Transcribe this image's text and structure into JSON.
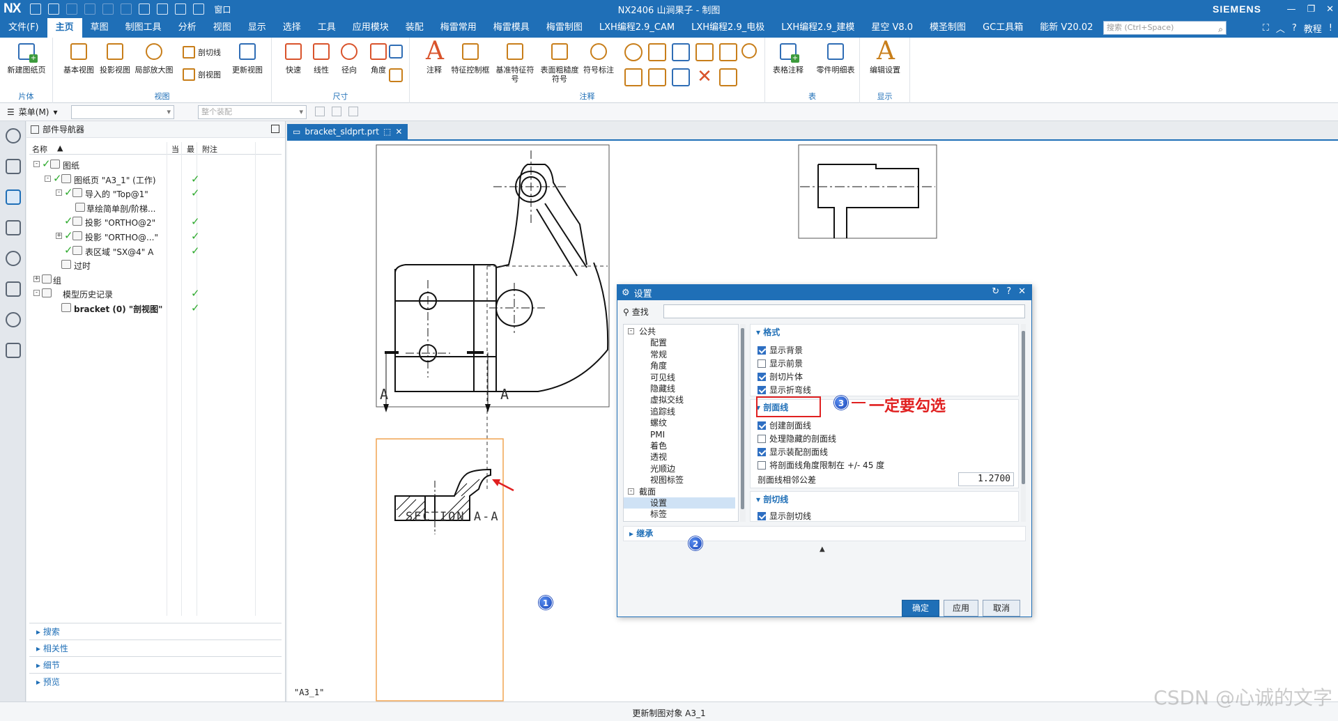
{
  "titlebar": {
    "logo": "NX",
    "window_label": "窗口",
    "title": "NX2406 山涧果子 - 制图",
    "brand": "SIEMENS"
  },
  "menubar": {
    "tabs": [
      "文件(F)",
      "主页",
      "草图",
      "制图工具",
      "分析",
      "视图",
      "显示",
      "选择",
      "工具",
      "应用模块",
      "装配",
      "梅雷常用",
      "梅雷模具",
      "梅雷制图",
      "LXH编程2.9_CAM",
      "LXH编程2.9_电极",
      "LXH编程2.9_建模",
      "星空 V8.0",
      "模圣制图",
      "GC工具箱",
      "能新 V20.02"
    ],
    "active_index": 1,
    "search_placeholder": "搜索 (Ctrl+Space)",
    "tutorial": "教程"
  },
  "ribbon": {
    "new_sheet": "新建图纸页",
    "group_sheet": "片体",
    "base_view": "基本视图",
    "proj_view": "投影视图",
    "detail_view": "局部放大图",
    "section_line": "剖切线",
    "section_view": "剖视图",
    "update_view": "更新视图",
    "group_view": "视图",
    "quick": "快速",
    "linear": "线性",
    "radial": "径向",
    "angle": "角度",
    "group_dim": "尺寸",
    "note": "注释",
    "fcf": "特征控制框",
    "datum": "基准特征符号",
    "surface": "表面粗糙度符号",
    "symbol": "符号标注",
    "group_anno": "注释",
    "table_note": "表格注释",
    "parts_list": "零件明细表",
    "group_table": "表",
    "edit_settings": "编辑设置",
    "group_display": "显示"
  },
  "toolbar2": {
    "menu": "菜单(M)",
    "filter_placeholder": "整个装配"
  },
  "navigator": {
    "title": "部件导航器",
    "col_name": "名称",
    "col_current": "当",
    "col_latest": "最",
    "col_note": "附注",
    "rows": [
      {
        "label": "图纸"
      },
      {
        "label": "图纸页 \"A3_1\" (工作)"
      },
      {
        "label": "导入的 \"Top@1\""
      },
      {
        "label": "草绘简单剖/阶梯..."
      },
      {
        "label": "投影 \"ORTHO@2\""
      },
      {
        "label": "投影 \"ORTHO@...\""
      },
      {
        "label": "表区域 \"SX@4\" A"
      },
      {
        "label": "过时"
      },
      {
        "label": "组"
      },
      {
        "label": "模型历史记录"
      },
      {
        "label": "bracket (0) \"剖视图\""
      }
    ],
    "sections": [
      "搜索",
      "相关性",
      "细节",
      "预览"
    ]
  },
  "document": {
    "tab": "bracket_sldprt.prt",
    "section_label": "SECTION A-A",
    "view_label_a1": "A",
    "view_label_a2": "A",
    "sheet_label": "\"A3_1\""
  },
  "dialog": {
    "title": "设置",
    "find_label": "查找",
    "tree": [
      {
        "label": "公共",
        "level": 0,
        "expander": "-"
      },
      {
        "label": "配置",
        "level": 1
      },
      {
        "label": "常规",
        "level": 1
      },
      {
        "label": "角度",
        "level": 1
      },
      {
        "label": "可见线",
        "level": 1
      },
      {
        "label": "隐藏线",
        "level": 1
      },
      {
        "label": "虚拟交线",
        "level": 1
      },
      {
        "label": "追踪线",
        "level": 1
      },
      {
        "label": "螺纹",
        "level": 1
      },
      {
        "label": "PMI",
        "level": 1
      },
      {
        "label": "着色",
        "level": 1
      },
      {
        "label": "透视",
        "level": 1
      },
      {
        "label": "光顺边",
        "level": 1
      },
      {
        "label": "视图标签",
        "level": 1
      },
      {
        "label": "截面",
        "level": 0,
        "expander": "-"
      },
      {
        "label": "设置",
        "level": 1,
        "selected": true
      },
      {
        "label": "标签",
        "level": 1
      }
    ],
    "format_header": "格式",
    "format_options": [
      {
        "label": "显示背景",
        "checked": true
      },
      {
        "label": "显示前景",
        "checked": false
      },
      {
        "label": "剖切片体",
        "checked": true
      },
      {
        "label": "显示折弯线",
        "checked": true
      }
    ],
    "hatch_header": "剖面线",
    "hatch_options": [
      {
        "label": "创建剖面线",
        "checked": true
      },
      {
        "label": "处理隐藏的剖面线",
        "checked": false
      },
      {
        "label": "显示装配剖面线",
        "checked": true
      },
      {
        "label": "将剖面线角度限制在 +/- 45 度",
        "checked": false
      }
    ],
    "tolerance_label": "剖面线相邻公差",
    "tolerance_value": "1.2700",
    "cutline_header": "剖切线",
    "cutline_option": "显示剖切线",
    "inherit": "继承",
    "ok": "确定",
    "apply": "应用",
    "cancel": "取消"
  },
  "callouts": {
    "badge1": "1",
    "badge2": "2",
    "badge3": "3",
    "note": "一定要勾选"
  },
  "status": {
    "text": "更新制图对象 A3_1"
  },
  "watermark": "CSDN @心诚的文字"
}
